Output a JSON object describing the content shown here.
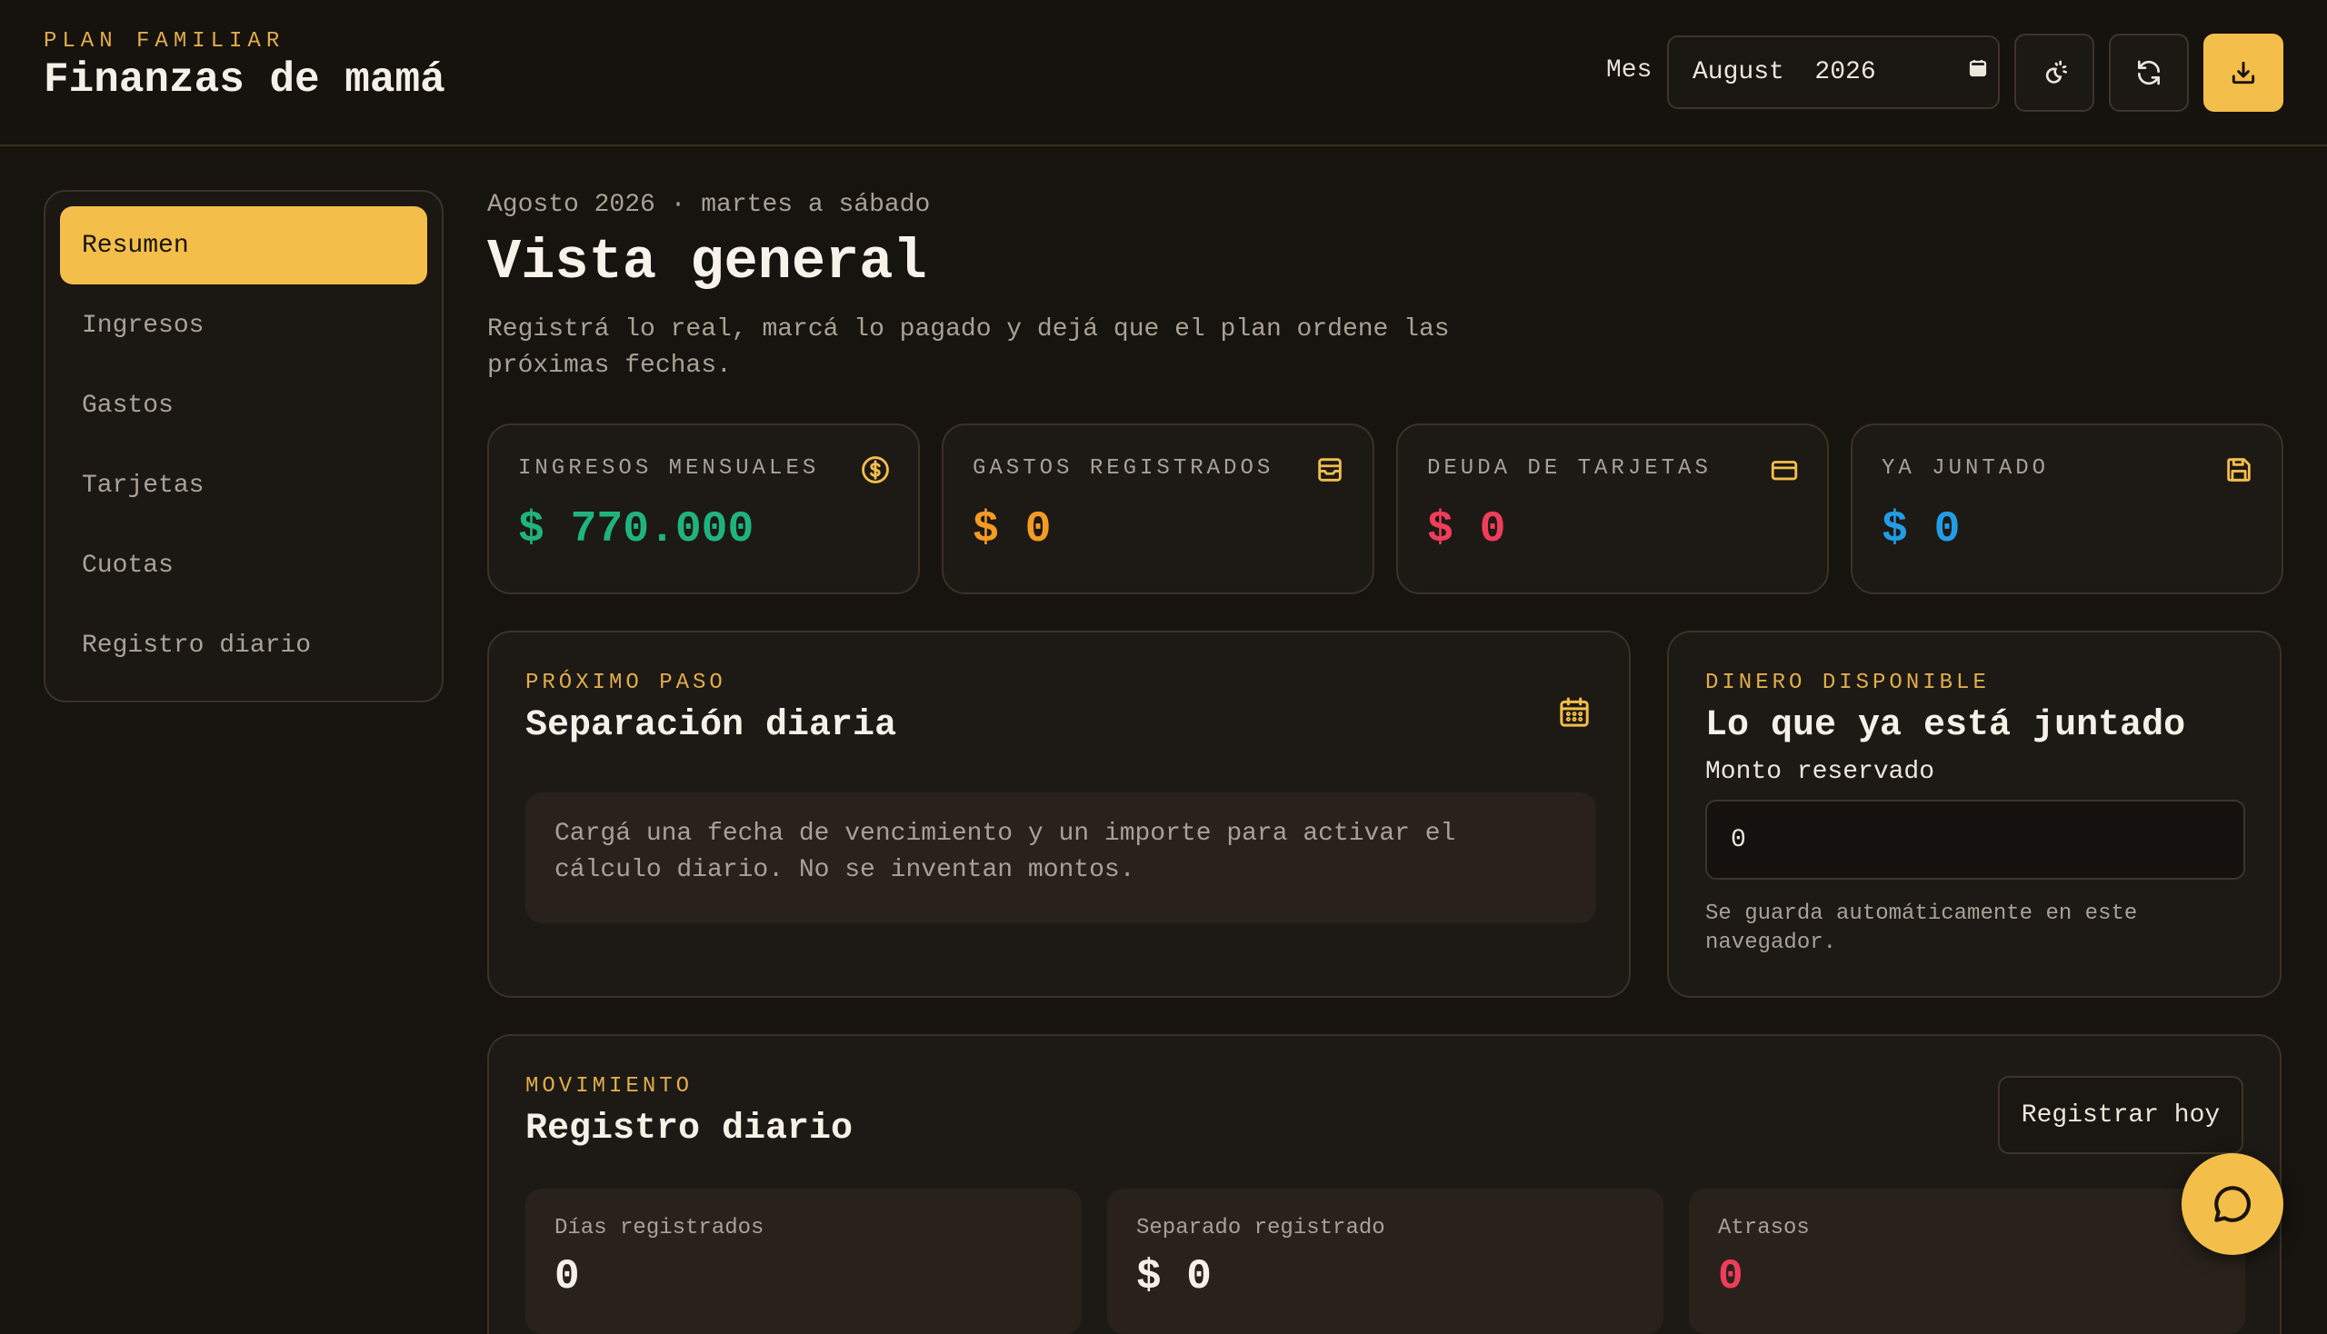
{
  "header": {
    "kicker": "PLAN FAMILIAR",
    "title": "Finanzas de mamá",
    "month_label": "Mes",
    "month_value": "August  2026"
  },
  "sidebar": {
    "items": [
      {
        "label": "Resumen",
        "active": true
      },
      {
        "label": "Ingresos"
      },
      {
        "label": "Gastos"
      },
      {
        "label": "Tarjetas"
      },
      {
        "label": "Cuotas"
      },
      {
        "label": "Registro diario"
      }
    ]
  },
  "overview": {
    "eyebrow": "Agosto 2026 · martes a sábado",
    "title": "Vista general",
    "description": "Registrá lo real, marcá lo pagado y dejá que el plan ordene las próximas fechas."
  },
  "stats": [
    {
      "label": "INGRESOS MENSUALES",
      "value": "$ 770.000",
      "color": "#1fb47d",
      "icon": "dollar-circle-icon"
    },
    {
      "label": "GASTOS REGISTRADOS",
      "value": "$ 0",
      "color": "#f39b25",
      "icon": "receipt-icon"
    },
    {
      "label": "DEUDA DE TARJETAS",
      "value": "$ 0",
      "color": "#ef3d5a",
      "icon": "credit-card-icon"
    },
    {
      "label": "YA JUNTADO",
      "value": "$ 0",
      "color": "#229de4",
      "icon": "save-icon"
    }
  ],
  "next_step": {
    "kicker": "PRÓXIMO PASO",
    "title": "Separación diaria",
    "message": "Cargá una fecha de vencimiento y un importe para activar el cálculo diario. No se inventan montos."
  },
  "available": {
    "kicker": "DINERO DISPONIBLE",
    "title": "Lo que ya está juntado",
    "field_label": "Monto reservado",
    "field_value": "0",
    "hint": "Se guarda automáticamente en este navegador."
  },
  "daily": {
    "kicker": "MOVIMIENTO",
    "title": "Registro diario",
    "button": "Registrar hoy",
    "cards": [
      {
        "label": "Días registrados",
        "value": "0",
        "color": "#f6f1e8"
      },
      {
        "label": "Separado registrado",
        "value": "$ 0",
        "color": "#f6f1e8"
      },
      {
        "label": "Atrasos",
        "value": "0",
        "color": "#ef3d5a"
      }
    ]
  },
  "colors": {
    "accent": "#f3bf4a",
    "background": "#17130f"
  }
}
